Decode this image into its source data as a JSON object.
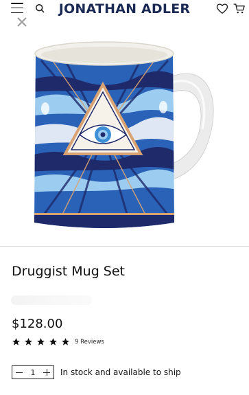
{
  "header": {
    "brand": "JONATHAN ADLER",
    "icons": [
      "menu-icon",
      "search-icon",
      "heart-icon",
      "cart-icon"
    ]
  },
  "overlay": {
    "close_icon": "close-icon"
  },
  "product": {
    "title": "Druggist Mug Set",
    "price": "$128.00",
    "rating": 5,
    "rating_max": 5,
    "reviews_label": "9 Reviews",
    "quantity": "1",
    "stock_text": "In stock and available to ship",
    "image_alt_icon": "mug-image"
  },
  "colors": {
    "brand_navy": "#1b2a55",
    "mug_blue": "#2a62b8",
    "mug_navy": "#1f2a6b",
    "mug_gold": "#d9a273",
    "mug_light_blue": "#9ccdf0"
  }
}
